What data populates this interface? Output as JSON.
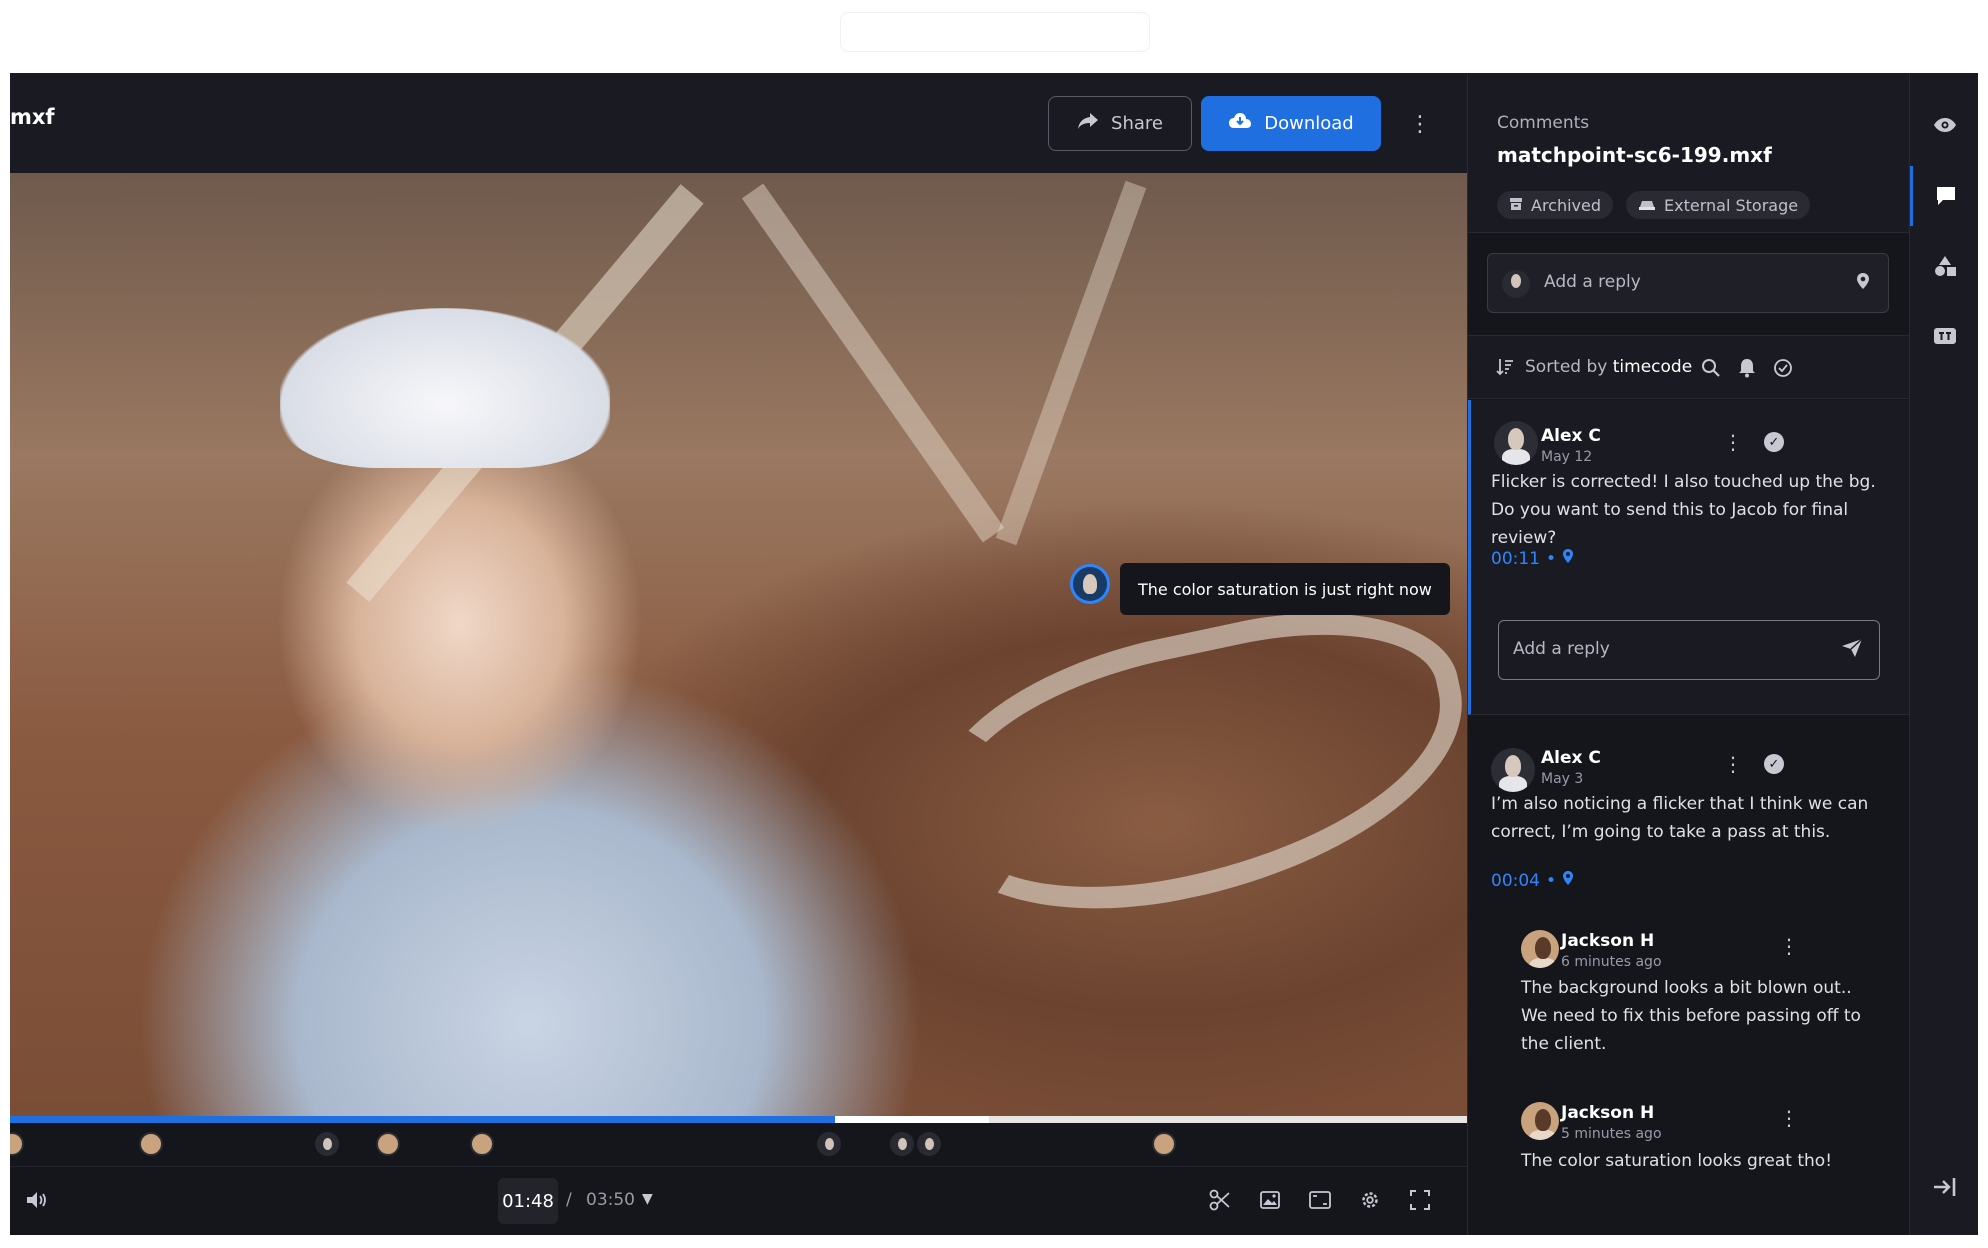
{
  "player": {
    "file_name_partial": "mxf",
    "share_label": "Share",
    "download_label": "Download",
    "tooltip": "The color saturation is just right now",
    "current_time": "01:48",
    "separator": "/",
    "total_time": "03:50",
    "progress_played_pct": 56.6,
    "progress_buffered_pct": 67.2
  },
  "comments_panel": {
    "label": "Comments",
    "file_name": "matchpoint-sc6-199.mxf",
    "tags": [
      {
        "label": "Archived",
        "icon": "archive-icon"
      },
      {
        "label": "External Storage",
        "icon": "storage-icon"
      }
    ],
    "reply_placeholder": "Add a reply",
    "sort_prefix": "Sorted by",
    "sort_value": "timecode",
    "comments": [
      {
        "author": "Alex C",
        "date": "May 12",
        "text": "Flicker is corrected! I also touched up the bg. Do you want to send this to Jacob for final review?",
        "timecode": "00:11",
        "reply_placeholder": "Add a reply"
      },
      {
        "author": "Alex C",
        "date": "May 3",
        "text": "I’m also noticing a flicker that I think we can correct, I’m going to take a pass at this.",
        "timecode": "00:04",
        "replies": [
          {
            "author": "Jackson H",
            "date": "6 minutes ago",
            "text": "The background looks a bit blown out.. We need to fix this before passing off to the client."
          },
          {
            "author": "Jackson H",
            "date": "5 minutes ago",
            "text": "The color saturation looks great tho!"
          }
        ]
      }
    ]
  },
  "colors": {
    "accent": "#1f6fe0",
    "timecode": "#2e86ff",
    "background": "#15151c"
  }
}
